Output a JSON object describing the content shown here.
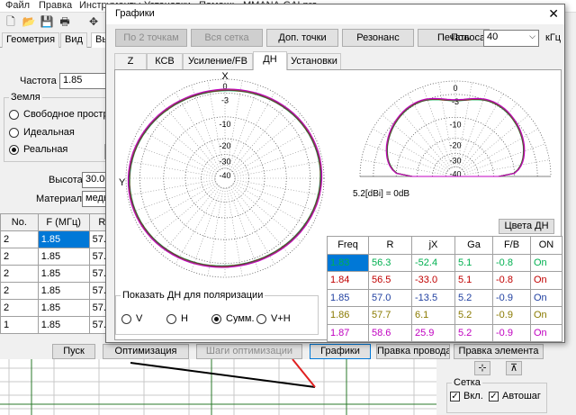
{
  "menu": [
    "Файл",
    "Правка",
    "Инструменты",
    "Установки",
    "Помощь",
    "MMANA-GALpro"
  ],
  "main": {
    "tabs": [
      "Геометрия",
      "Вид",
      "Вы"
    ],
    "freq_label": "Частота",
    "freq_value": "1.85",
    "ground_title": "Земля",
    "ground_options": [
      "Свободное простран",
      "Идеальная",
      "Реальная"
    ],
    "ground_selected": 2,
    "ground_button": "П",
    "height_label": "Высота",
    "height_value": "30.00",
    "material_label": "Материал",
    "material_value": "медь",
    "table_headers": [
      "No.",
      "F (МГц)",
      "R"
    ],
    "table_rows": [
      [
        "2",
        "1.85",
        "57.0"
      ],
      [
        "2",
        "1.85",
        "57.0"
      ],
      [
        "2",
        "1.85",
        "57.0"
      ],
      [
        "2",
        "1.85",
        "57.0"
      ],
      [
        "2",
        "1.85",
        "57.0"
      ],
      [
        "1",
        "1.85",
        "57.0"
      ]
    ],
    "bottom_buttons": [
      "Пуск",
      "Оптимизация",
      "Шаги оптимизации",
      "Графики",
      "Правка провода",
      "Правка элемента"
    ],
    "grid_title": "Сетка",
    "grid_checks": [
      {
        "label": "Вкл.",
        "checked": true
      },
      {
        "label": "Автошаг",
        "checked": true
      }
    ]
  },
  "graphs": {
    "title": "Графики",
    "buttons": [
      "По 2 точкам",
      "Вся сетка",
      "Доп. точки",
      "Резонанс",
      "Печать"
    ],
    "band_label": "Полоса",
    "band_value": "40",
    "band_unit": "кГц",
    "tabs": [
      "Z",
      "КСВ",
      "Усиление/FB",
      "ДН",
      "Установки"
    ],
    "active_tab": 3,
    "axis_x": "X",
    "axis_y": "Y",
    "horiz_scale_labels": [
      "0",
      "-3",
      "-10",
      "-20",
      "-30",
      "-40"
    ],
    "vert_scale_labels": [
      "0",
      "-3",
      "-10",
      "-20",
      "-30",
      "-40"
    ],
    "gain_note": "5.2[dBi] = 0dB",
    "colors_button": "Цвета ДН",
    "pol_title": "Показать ДН для поляризации",
    "pol_options": [
      "V",
      "H",
      "Сумм.",
      "V+H"
    ],
    "pol_selected": 2,
    "table_headers": [
      "Freq",
      "R",
      "jX",
      "Ga",
      "F/B",
      "ON"
    ],
    "table_rows": [
      {
        "color": "#00b050",
        "cells": [
          "1.83",
          "56.3",
          "-52.4",
          "5.1",
          "-0.8",
          "On"
        ]
      },
      {
        "color": "#c00000",
        "cells": [
          "1.84",
          "56.5",
          "-33.0",
          "5.1",
          "-0.8",
          "On"
        ]
      },
      {
        "color": "#1f3fa0",
        "cells": [
          "1.85",
          "57.0",
          "-13.5",
          "5.2",
          "-0.9",
          "On"
        ]
      },
      {
        "color": "#8a7a00",
        "cells": [
          "1.86",
          "57.7",
          "6.1",
          "5.2",
          "-0.9",
          "On"
        ]
      },
      {
        "color": "#c000c0",
        "cells": [
          "1.87",
          "58.6",
          "25.9",
          "5.2",
          "-0.9",
          "On"
        ]
      }
    ],
    "selected_row": 0
  }
}
